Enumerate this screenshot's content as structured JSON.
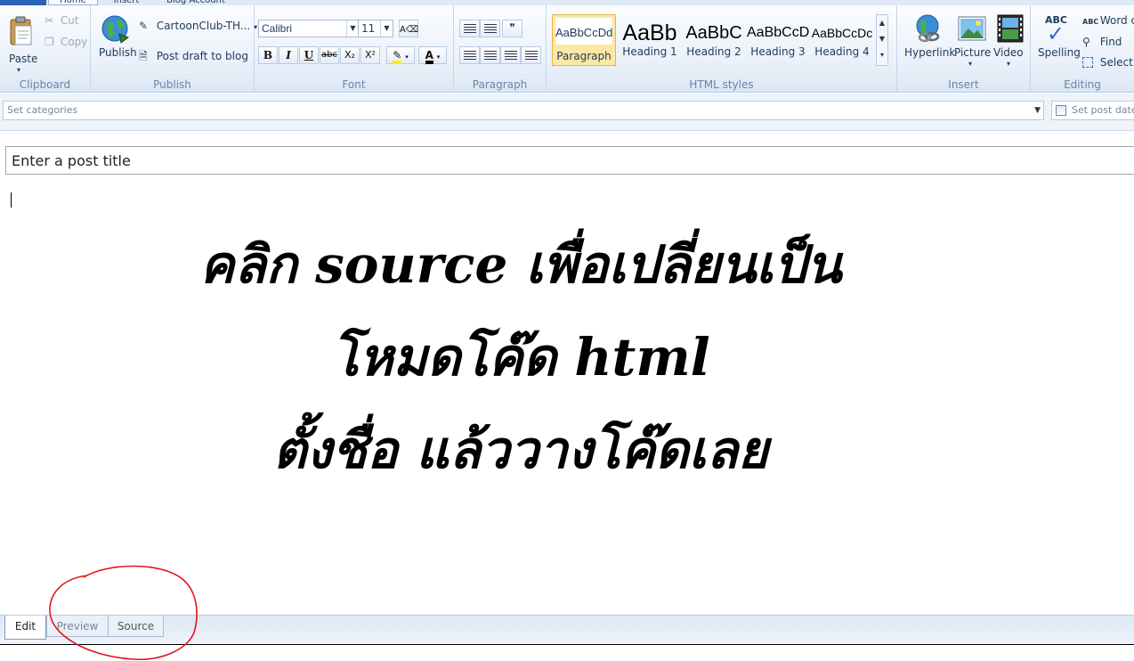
{
  "ribbon": {
    "tabs": [
      "Home",
      "Insert",
      "Blog Account"
    ],
    "clipboard": {
      "label": "Clipboard",
      "paste": "Paste",
      "cut": "Cut",
      "copy": "Copy"
    },
    "publish": {
      "label": "Publish",
      "publish": "Publish",
      "account": "CartoonClub-TH...",
      "post_draft": "Post draft to blog"
    },
    "font": {
      "label": "Font",
      "family": "Calibri",
      "size": "11",
      "bold": "B",
      "italic": "I",
      "underline": "U",
      "strike": "abc",
      "subscript": "X₂",
      "superscript": "X²",
      "font_color": "A"
    },
    "paragraph": {
      "label": "Paragraph"
    },
    "styles": {
      "label": "HTML styles",
      "items": [
        {
          "sample": "AaBbCcDd",
          "name": "Paragraph"
        },
        {
          "sample": "AaBb",
          "name": "Heading 1"
        },
        {
          "sample": "AaBbC",
          "name": "Heading 2"
        },
        {
          "sample": "AaBbCcD",
          "name": "Heading 3"
        },
        {
          "sample": "AaBbCcDc",
          "name": "Heading 4"
        }
      ]
    },
    "insert": {
      "label": "Insert",
      "hyperlink": "Hyperlink",
      "picture": "Picture",
      "video": "Video"
    },
    "editing": {
      "label": "Editing",
      "spelling": "Spelling",
      "spelling_icon": "ABC",
      "word_count": "Word co",
      "find": "Find",
      "select_all": "Select a"
    }
  },
  "catbar": {
    "categories_placeholder": "Set categories",
    "post_date": "Set post date"
  },
  "editor": {
    "title_placeholder": "Enter a post title",
    "lines": [
      "คลิก source เพื่อเปลี่ยนเป็น",
      "โหมดโค๊ด html",
      "ตั้งชื่อ แล้ววางโค๊ดเลย"
    ]
  },
  "view_tabs": {
    "edit": "Edit",
    "preview": "Preview",
    "source": "Source"
  },
  "colors": {
    "annotation": "#e0141e",
    "active_style": "#fde7a4",
    "ribbon_text": "#1e395b"
  }
}
